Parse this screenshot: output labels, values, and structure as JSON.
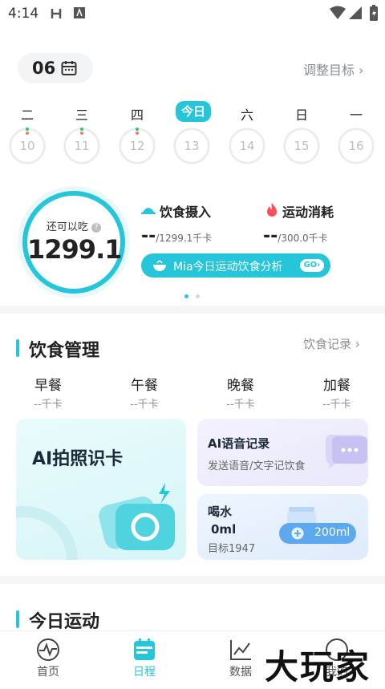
{
  "status_bar": {
    "time": "4:14"
  },
  "header": {
    "date": "06",
    "adjust_goal": "调整目标"
  },
  "week": {
    "today_label": "今日",
    "days": [
      {
        "weekday": "二",
        "date": "10"
      },
      {
        "weekday": "三",
        "date": "11"
      },
      {
        "weekday": "四",
        "date": "12"
      },
      {
        "weekday": "今日",
        "date": "13"
      },
      {
        "weekday": "六",
        "date": "14"
      },
      {
        "weekday": "日",
        "date": "15"
      },
      {
        "weekday": "一",
        "date": "16"
      }
    ]
  },
  "summary": {
    "remaining_caption": "还可以吃",
    "remaining_value": "1299.1",
    "intake_title": "饮食摄入",
    "intake_value": "--",
    "intake_target": "/1299.1千卡",
    "burn_title": "运动消耗",
    "burn_value": "--",
    "burn_target": "/300.0千卡",
    "mia_label": "Mia今日运动饮食分析",
    "go_label": "GO"
  },
  "diet": {
    "title": "饮食管理",
    "record_link": "饮食记录",
    "meals": [
      {
        "name": "早餐",
        "kcal": "--千卡"
      },
      {
        "name": "午餐",
        "kcal": "--千卡"
      },
      {
        "name": "晚餐",
        "kcal": "--千卡"
      },
      {
        "name": "加餐",
        "kcal": "--千卡"
      }
    ],
    "ai_photo": "AI拍照识卡",
    "voice_title": "AI语音记录",
    "voice_sub": "发送语音/文字记饮食",
    "water_title": "喝水",
    "water_amount": "0ml",
    "water_goal": "目标1947",
    "water_button": "200ml"
  },
  "exercise": {
    "title": "今日运动"
  },
  "nav": {
    "home": "首页",
    "schedule": "日程",
    "data": "数据",
    "mine": "我的"
  },
  "watermark": "大玩家",
  "colors": {
    "accent": "#26c6da",
    "water": "#5da9f0"
  }
}
